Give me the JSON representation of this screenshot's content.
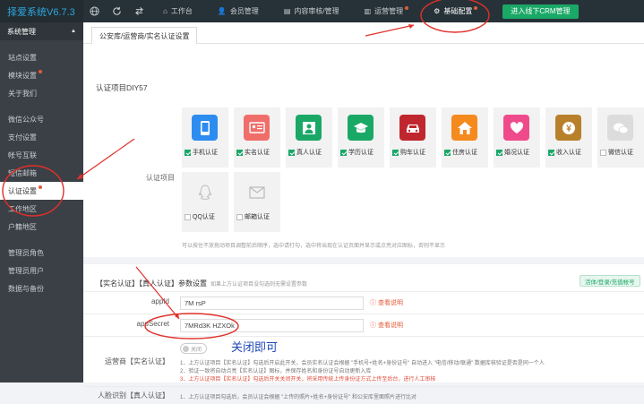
{
  "topbar": {
    "brand": "择爱系统V6.7.3",
    "nav": [
      {
        "label": "工作台",
        "icon": "home-icon",
        "dot": false,
        "active": false
      },
      {
        "label": "会员管理",
        "icon": "user-icon",
        "dot": false,
        "active": false
      },
      {
        "label": "内容审核/管理",
        "icon": "doc-icon",
        "dot": false,
        "active": false
      },
      {
        "label": "运营管理",
        "icon": "chart-icon",
        "dot": true,
        "active": false
      },
      {
        "label": "基础配置",
        "icon": "gear-icon",
        "dot": true,
        "active": true
      }
    ],
    "crm_button": "进入线下CRM管理"
  },
  "sidebar": {
    "header": "系统管理",
    "items": [
      {
        "label": "站点设置",
        "dot": false,
        "active": false
      },
      {
        "label": "模块设置",
        "dot": true,
        "active": false
      },
      {
        "label": "关于我们",
        "dot": false,
        "active": false
      },
      {
        "label": "微信公众号",
        "dot": false,
        "active": false
      },
      {
        "label": "支付设置",
        "dot": false,
        "active": false
      },
      {
        "label": "帐号互联",
        "dot": false,
        "active": false
      },
      {
        "label": "短信邮箱",
        "dot": false,
        "active": false
      },
      {
        "label": "认证设置",
        "dot": true,
        "active": true
      },
      {
        "label": "工作地区",
        "dot": false,
        "active": false
      },
      {
        "label": "户籍地区",
        "dot": false,
        "active": false
      },
      {
        "label": "管理员角色",
        "dot": false,
        "active": false
      },
      {
        "label": "管理员用户",
        "dot": false,
        "active": false
      },
      {
        "label": "数据与备份",
        "dot": false,
        "active": false
      }
    ]
  },
  "tab": "公安库/运营商/实名认证设置",
  "section_title": "认证项目DIY57",
  "item_label": "认证项目",
  "cards": [
    {
      "label": "手机认证",
      "checked": true,
      "color": "#2d8cf0",
      "icon": "phone-icon"
    },
    {
      "label": "实名认证",
      "checked": true,
      "color": "#f06e6a",
      "icon": "id-card-icon"
    },
    {
      "label": "真人认证",
      "checked": true,
      "color": "#1aa867",
      "icon": "person-icon"
    },
    {
      "label": "学历认证",
      "checked": true,
      "color": "#1aa867",
      "icon": "graduation-cap-icon"
    },
    {
      "label": "购车认证",
      "checked": true,
      "color": "#c0262d",
      "icon": "car-icon"
    },
    {
      "label": "住房认证",
      "checked": true,
      "color": "#f58a1f",
      "icon": "house-icon"
    },
    {
      "label": "婚况认证",
      "checked": true,
      "color": "#ef4b8c",
      "icon": "heart-icon"
    },
    {
      "label": "收入认证",
      "checked": true,
      "color": "#b9802b",
      "icon": "yuan-icon"
    },
    {
      "label": "微信认证",
      "checked": false,
      "color": "#dcdcdc",
      "icon": "wechat-icon"
    },
    {
      "label": "QQ认证",
      "checked": false,
      "color": "#dcdcdc",
      "icon": "qq-icon"
    },
    {
      "label": "邮箱认证",
      "checked": false,
      "color": "#dcdcdc",
      "icon": "mail-icon"
    }
  ],
  "hint": "可以按住不放拖动项目调整前后顺序，选中请打勾，选中将出现在认证页面并显示或点亮对应图标，否则不显示",
  "param": {
    "title": "【实名认证】【真人认证】参数设置",
    "subtitle": "如果上方认证项目没勾选则无需设置参数",
    "badge": "活体/登录/充值帐号"
  },
  "fields": [
    {
      "label": "appId",
      "value": "7M                    rsP",
      "link": "查看说明"
    },
    {
      "label": "appSecret",
      "value": "7MRd3K                              HZXOk",
      "link": "查看说明"
    }
  ],
  "operator": {
    "label": "运营商【实名认证】",
    "toggle": "关闭",
    "annotation": "关闭即可",
    "notes": [
      "1．上方认证项目【实名认证】勾选后开启此开关，会员实名认证会根据 \"手机号+姓名+身份证号\" 自动进入 \"电信/移动/联通\" 数据库核验证是否是同一个人",
      "2．验证一致将自动点亮【实名认证】图标，并保存姓名和身份证号自动更新入库",
      "3．上方认证项目【实名认证】勾选后开关关闭开关，将采用传统上传身份证方式上传至后台，进行人工审核"
    ]
  },
  "bottom": {
    "label": "人脸识别【真人认证】",
    "note": "1．上方认证项目勾选后，会员认证会根据 \"上传的照片+姓名+身份证号\" 和公安库里面照片进行比对"
  }
}
